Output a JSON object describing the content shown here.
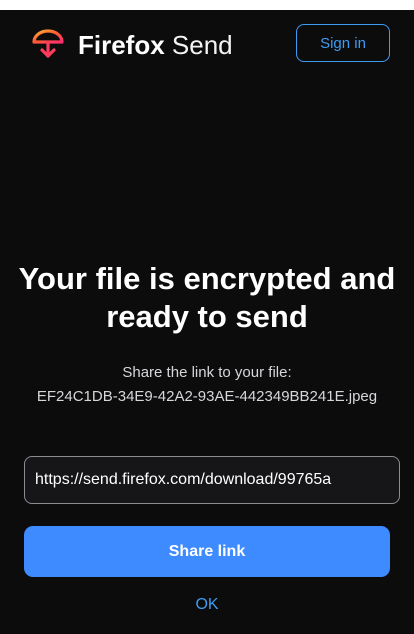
{
  "header": {
    "brand_strong": "Firefox",
    "brand_light": "Send",
    "signin_label": "Sign in",
    "logo_icon": "firefox-send-logo-icon"
  },
  "main": {
    "headline": "Your file is encrypted and ready to send",
    "share_prompt": "Share the link to your file:",
    "filename": "EF24C1DB-34E9-42A2-93AE-442349BB241E.jpeg",
    "link_value": "https://send.firefox.com/download/99765a"
  },
  "actions": {
    "share_label": "Share link",
    "ok_label": "OK"
  },
  "colors": {
    "background": "#0c0c0d",
    "accent": "#3d8bff",
    "link": "#3d9bf2",
    "logo_red": "#ff3b5c",
    "logo_orange": "#ff8a1f"
  }
}
